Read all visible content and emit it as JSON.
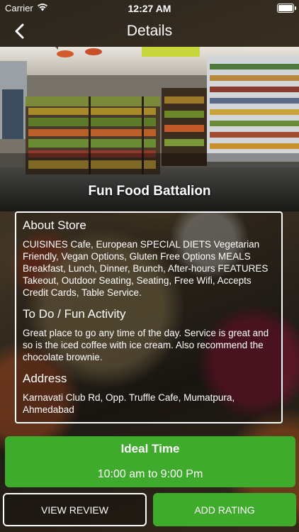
{
  "status": {
    "carrier": "Carrier",
    "time": "12:27 AM"
  },
  "nav": {
    "title": "Details"
  },
  "store": {
    "name": "Fun Food Battalion"
  },
  "about": {
    "title": "About Store",
    "text": "CUISINES Cafe, European SPECIAL DIETS Vegetarian Friendly, Vegan Options, Gluten Free Options MEALS Breakfast, Lunch, Dinner, Brunch, After-hours FEATURES Takeout, Outdoor Seating, Seating, Free Wifi, Accepts Credit Cards, Table Service."
  },
  "todo": {
    "title": "To Do / Fun Activity",
    "text": "Great place to go any time of the day. Service is great and so is the iced coffee with ice cream. Also recommend the chocolate brownie."
  },
  "address": {
    "title": "Address",
    "text": "Karnavati Club Rd, Opp. Truffle Cafe, Mumatpura, Ahmedabad"
  },
  "ideal": {
    "title": "Ideal Time",
    "time": "10:00 am to 9:00 Pm"
  },
  "buttons": {
    "review": "VIEW REVIEW",
    "rating": "ADD RATING"
  },
  "colors": {
    "accent": "#3fab2c"
  }
}
